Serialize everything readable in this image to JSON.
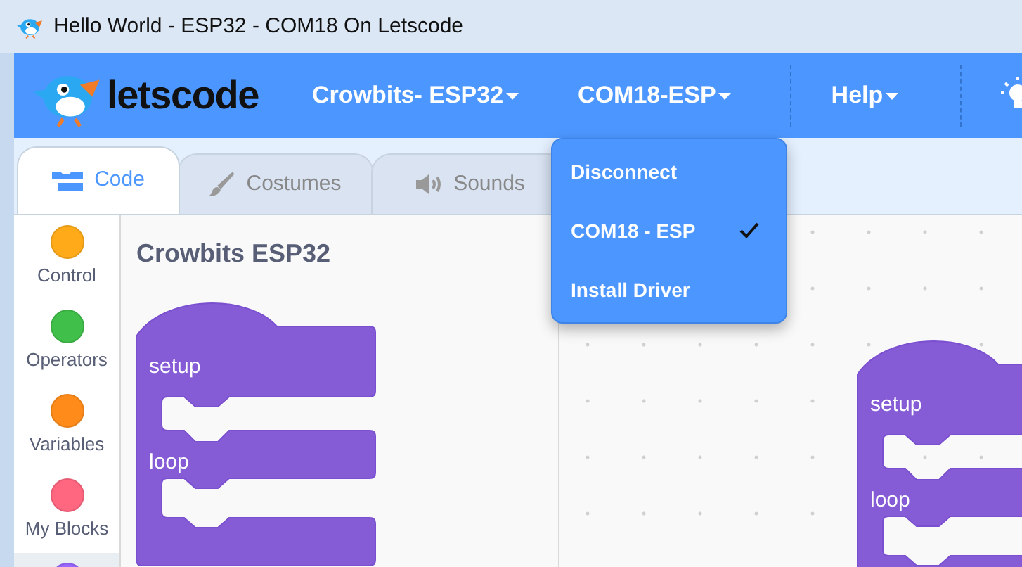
{
  "window": {
    "title": "Hello World - ESP32 - COM18 On Letscode"
  },
  "logo_text": "letscode",
  "menus": [
    {
      "label": "Crowbits- ESP32"
    },
    {
      "label": "COM18-ESP",
      "open": true,
      "items": [
        {
          "label": "Disconnect",
          "checked": false
        },
        {
          "label": "COM18 - ESP",
          "checked": true
        },
        {
          "label": "Install Driver",
          "checked": false
        }
      ]
    },
    {
      "label": "Help"
    }
  ],
  "tabs": [
    {
      "label": "Code",
      "selected": true
    },
    {
      "label": "Costumes",
      "selected": false
    },
    {
      "label": "Sounds",
      "selected": false
    }
  ],
  "categories": [
    {
      "label": "Control",
      "color": "#ffab19",
      "selected": false
    },
    {
      "label": "Operators",
      "color": "#40bf4a",
      "selected": false
    },
    {
      "label": "Variables",
      "color": "#ff8c1a",
      "selected": false
    },
    {
      "label": "My Blocks",
      "color": "#ff6680",
      "selected": false
    },
    {
      "color": "#9966ff",
      "selected": true
    }
  ],
  "flyout": {
    "title": "Crowbits ESP32",
    "block": {
      "labels": [
        "setup",
        "loop"
      ]
    }
  },
  "workspace": {
    "block": {
      "labels": [
        "setup",
        "loop"
      ]
    }
  }
}
